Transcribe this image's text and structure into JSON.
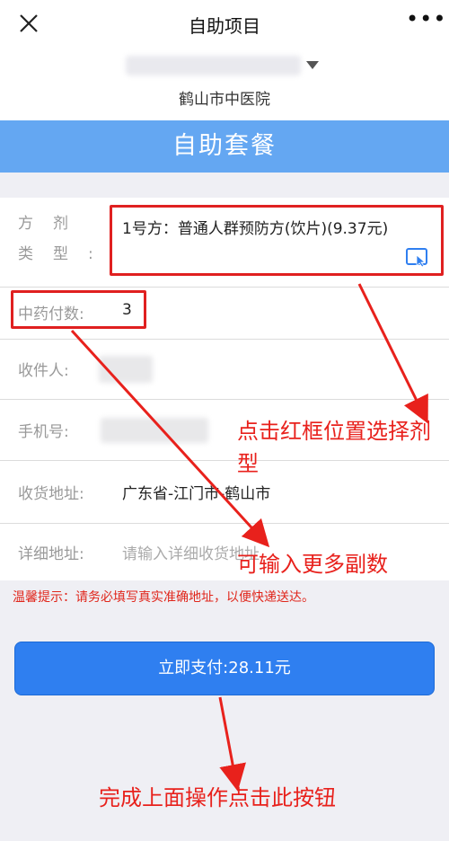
{
  "header": {
    "title": "自助项目",
    "more": "•••"
  },
  "hospital": {
    "name": "鹤山市中医院"
  },
  "banner": {
    "title": "自助套餐"
  },
  "form": {
    "prescription_type": {
      "label": "方剂类型:",
      "value": "1号方：普通人群预防方(饮片)(9.37元)"
    },
    "dose_count": {
      "label": "中药付数:",
      "value": "3"
    },
    "recipient": {
      "label": "收件人:"
    },
    "phone": {
      "label": "手机号:"
    },
    "region": {
      "label": "收货地址:",
      "value": "广东省-江门市-鹤山市"
    },
    "detail_address": {
      "label": "详细地址:",
      "placeholder": "请输入详细收货地址"
    }
  },
  "tip": "温馨提示：请务必填写真实准确地址，以便快递送达。",
  "pay_button": "立即支付:28.11元",
  "annotations": {
    "select_type": "点击红框位置选择剂型",
    "more_doses": "可输入更多副数",
    "finish": "完成上面操作点击此按钮"
  },
  "colors": {
    "banner": "#64a7f2",
    "pay_button": "#2f7ff0",
    "annotation_red": "#e8211c"
  }
}
